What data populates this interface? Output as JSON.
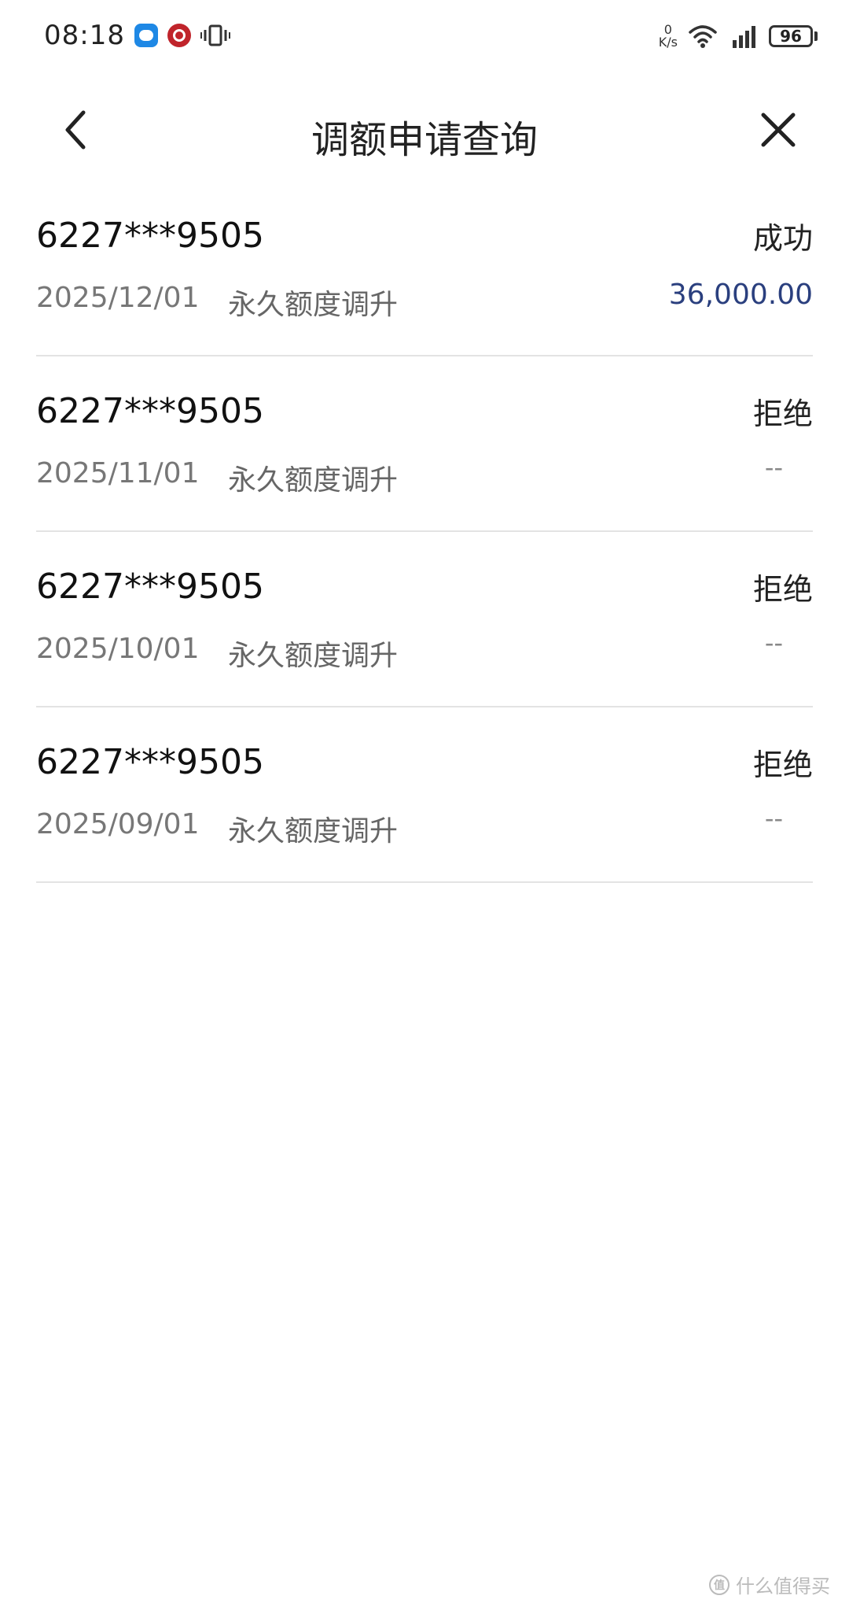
{
  "status_bar": {
    "time": "08:18",
    "net_speed_value": "0",
    "net_speed_unit": "K/s",
    "battery": "96",
    "icons": [
      "chat-app-icon",
      "bank-app-icon",
      "vibrate-icon",
      "wifi-icon",
      "signal-icon",
      "battery-icon"
    ]
  },
  "nav": {
    "title": "调额申请查询",
    "back_icon": "chevron-left-icon",
    "close_icon": "close-icon"
  },
  "records": [
    {
      "card": "6227***9505",
      "status": "成功",
      "date": "2025/12/01",
      "type": "永久额度调升",
      "amount": "36,000.00"
    },
    {
      "card": "6227***9505",
      "status": "拒绝",
      "date": "2025/11/01",
      "type": "永久额度调升",
      "amount": "--"
    },
    {
      "card": "6227***9505",
      "status": "拒绝",
      "date": "2025/10/01",
      "type": "永久额度调升",
      "amount": "--"
    },
    {
      "card": "6227***9505",
      "status": "拒绝",
      "date": "2025/09/01",
      "type": "永久额度调升",
      "amount": "--"
    }
  ],
  "colors": {
    "amount_accent": "#2a3f7e",
    "divider": "#e3e3e3",
    "secondary_text": "#777777"
  },
  "watermark": {
    "text": "什么值得买",
    "logo_text": "值"
  }
}
